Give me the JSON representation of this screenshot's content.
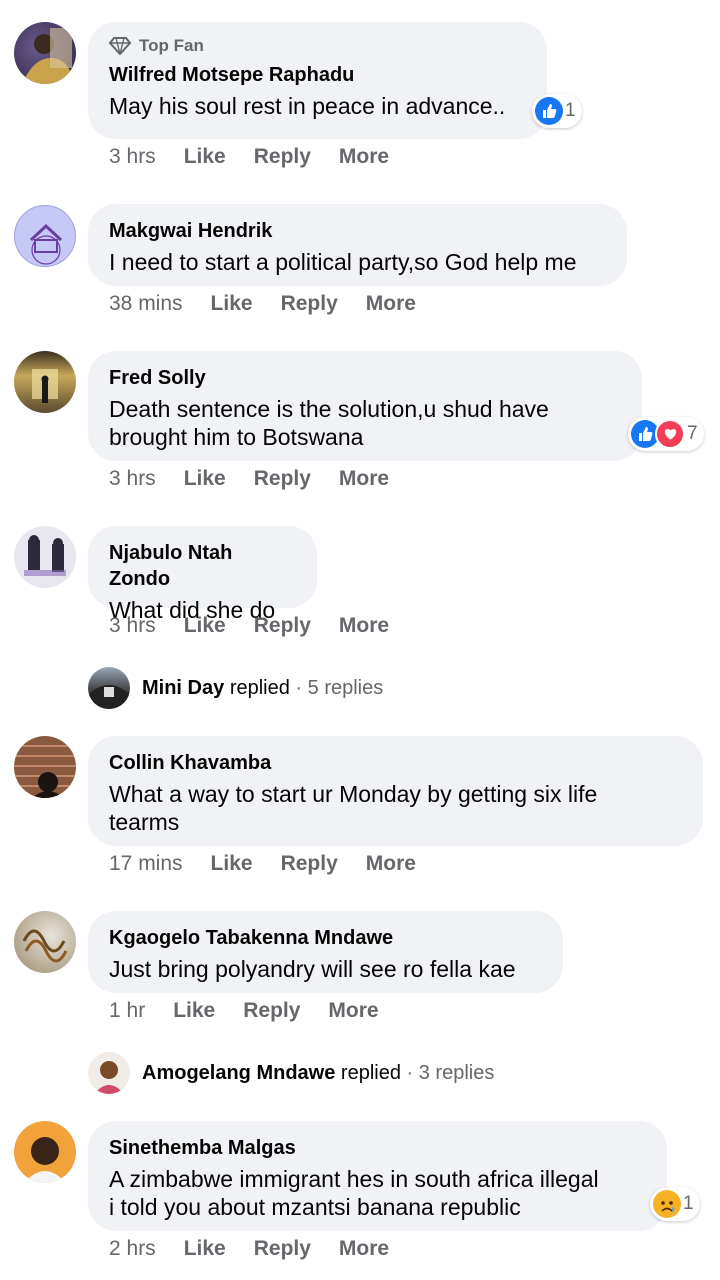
{
  "comments": [
    {
      "top_fan_label": "Top Fan",
      "author": "Wilfred Motsepe Raphadu",
      "text": "May his soul rest in peace in advance..",
      "time": "3 hrs",
      "reaction_count": "1",
      "reaction_types": [
        "like"
      ]
    },
    {
      "author": "Makgwai Hendrik",
      "text": "I need to start a political party,so God help me",
      "time": "38 mins"
    },
    {
      "author": "Fred Solly",
      "text_lines": [
        "Death sentence is the solution,u shud have",
        "brought him to Botswana"
      ],
      "time": "3 hrs",
      "reaction_count": "7",
      "reaction_types": [
        "like",
        "love"
      ]
    },
    {
      "author": "Njabulo Ntah Zondo",
      "text": "What did she do",
      "time": "3 hrs",
      "replies": {
        "name": "Mini Day",
        "verb": "replied",
        "meta": "· 5 replies"
      }
    },
    {
      "author": "Collin Khavamba",
      "text_lines": [
        "What a way to start ur Monday by getting six life",
        "tearms"
      ],
      "time": "17 mins"
    },
    {
      "author": "Kgaogelo Tabakenna Mndawe",
      "text": "Just bring polyandry will see ro fella kae",
      "time": "1 hr",
      "replies": {
        "name": "Amogelang Mndawe",
        "verb": "replied",
        "meta": "· 3 replies"
      }
    },
    {
      "author": "Sinethemba Malgas",
      "text_lines": [
        "A zimbabwe immigrant hes in south africa illegal",
        "i told you about mzantsi banana republic"
      ],
      "time": "2 hrs",
      "reaction_count": "1",
      "reaction_types": [
        "sad"
      ]
    }
  ],
  "actions": {
    "like": "Like",
    "reply": "Reply",
    "more": "More"
  },
  "colors": {
    "bubble": "#f0f2f5",
    "meta": "#65676b",
    "like_blue": "#1877f2",
    "love_red": "#f33e58",
    "sad_yellow": "#f7b125"
  }
}
